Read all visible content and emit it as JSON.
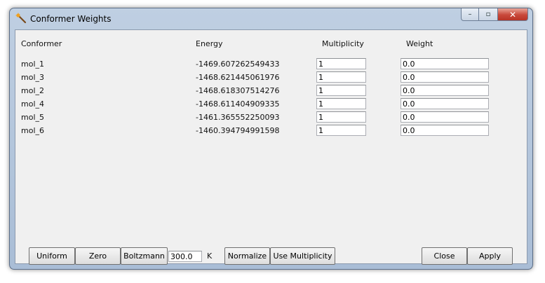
{
  "window": {
    "title": "Conformer Weights",
    "icon": "wand-icon",
    "caption": {
      "minimize": "–",
      "maximize": "▫",
      "close": "✕"
    }
  },
  "headers": {
    "conformer": "Conformer",
    "energy": "Energy",
    "multiplicity": "Multiplicity",
    "weight": "Weight"
  },
  "rows": [
    {
      "name": "mol_1",
      "energy": "-1469.607262549433",
      "multiplicity": "1",
      "weight": "0.0"
    },
    {
      "name": "mol_3",
      "energy": "-1468.621445061976",
      "multiplicity": "1",
      "weight": "0.0"
    },
    {
      "name": "mol_2",
      "energy": "-1468.618307514276",
      "multiplicity": "1",
      "weight": "0.0"
    },
    {
      "name": "mol_4",
      "energy": "-1468.611404909335",
      "multiplicity": "1",
      "weight": "0.0"
    },
    {
      "name": "mol_5",
      "energy": "-1461.365552250093",
      "multiplicity": "1",
      "weight": "0.0"
    },
    {
      "name": "mol_6",
      "energy": "-1460.394794991598",
      "multiplicity": "1",
      "weight": "0.0"
    }
  ],
  "buttons": {
    "uniform": "Uniform",
    "zero": "Zero",
    "boltzmann": "Boltzmann",
    "temperature": "300.0",
    "temperature_unit": "K",
    "normalize": "Normalize",
    "use_multiplicity": "Use Multiplicity",
    "close": "Close",
    "apply": "Apply"
  }
}
